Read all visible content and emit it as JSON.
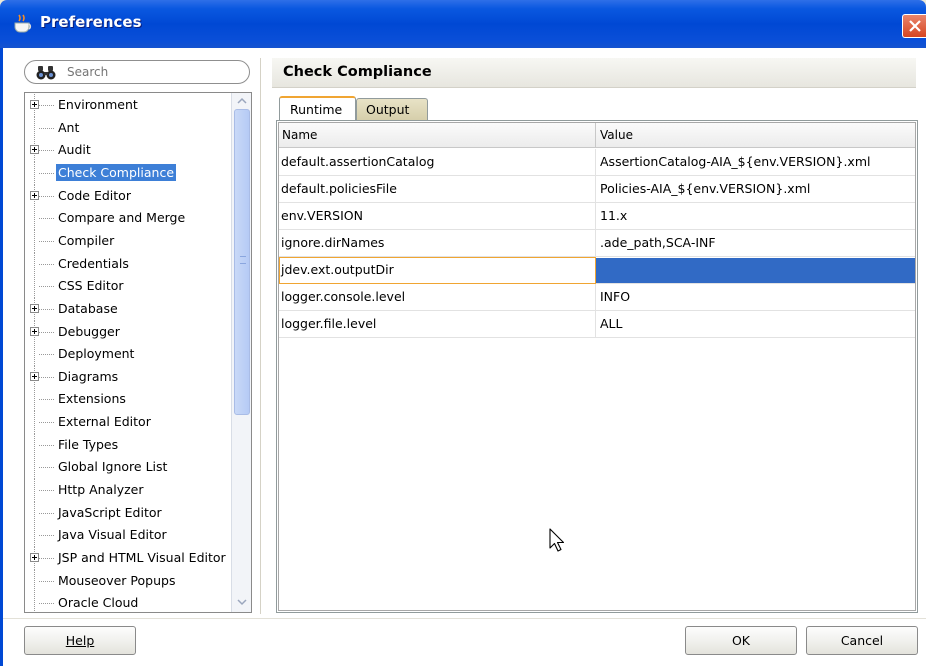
{
  "window": {
    "title": "Preferences"
  },
  "search": {
    "placeholder": "Search"
  },
  "tree": {
    "items": [
      {
        "label": "Environment",
        "expandable": true,
        "selected": false
      },
      {
        "label": "Ant",
        "expandable": false,
        "selected": false
      },
      {
        "label": "Audit",
        "expandable": true,
        "selected": false
      },
      {
        "label": "Check Compliance",
        "expandable": false,
        "selected": true
      },
      {
        "label": "Code Editor",
        "expandable": true,
        "selected": false
      },
      {
        "label": "Compare and Merge",
        "expandable": false,
        "selected": false
      },
      {
        "label": "Compiler",
        "expandable": false,
        "selected": false
      },
      {
        "label": "Credentials",
        "expandable": false,
        "selected": false
      },
      {
        "label": "CSS Editor",
        "expandable": false,
        "selected": false
      },
      {
        "label": "Database",
        "expandable": true,
        "selected": false
      },
      {
        "label": "Debugger",
        "expandable": true,
        "selected": false
      },
      {
        "label": "Deployment",
        "expandable": false,
        "selected": false
      },
      {
        "label": "Diagrams",
        "expandable": true,
        "selected": false
      },
      {
        "label": "Extensions",
        "expandable": false,
        "selected": false
      },
      {
        "label": "External Editor",
        "expandable": false,
        "selected": false
      },
      {
        "label": "File Types",
        "expandable": false,
        "selected": false
      },
      {
        "label": "Global Ignore List",
        "expandable": false,
        "selected": false
      },
      {
        "label": "Http Analyzer",
        "expandable": false,
        "selected": false
      },
      {
        "label": "JavaScript Editor",
        "expandable": false,
        "selected": false
      },
      {
        "label": "Java Visual Editor",
        "expandable": false,
        "selected": false
      },
      {
        "label": "JSP and HTML Visual Editor",
        "expandable": true,
        "selected": false
      },
      {
        "label": "Mouseover Popups",
        "expandable": false,
        "selected": false
      },
      {
        "label": "Oracle Cloud",
        "expandable": false,
        "selected": false
      }
    ]
  },
  "panel": {
    "title": "Check Compliance",
    "tabs": [
      {
        "label": "Runtime",
        "active": true
      },
      {
        "label": "Output",
        "active": false
      }
    ],
    "columns": {
      "name": "Name",
      "value": "Value"
    },
    "rows": [
      {
        "name": "default.assertionCatalog",
        "value": "AssertionCatalog-AIA_${env.VERSION}.xml"
      },
      {
        "name": "default.policiesFile",
        "value": "Policies-AIA_${env.VERSION}.xml"
      },
      {
        "name": "env.VERSION",
        "value": "11.x"
      },
      {
        "name": "ignore.dirNames",
        "value": ".ade_path,SCA-INF"
      },
      {
        "name": "jdev.ext.outputDir",
        "value": "",
        "editing": true
      },
      {
        "name": "logger.console.level",
        "value": "INFO"
      },
      {
        "name": "logger.file.level",
        "value": "ALL"
      }
    ]
  },
  "buttons": {
    "help": "Help",
    "ok": "OK",
    "cancel": "Cancel"
  },
  "colors": {
    "titlebar": "#0048d4",
    "selection": "#3d7fd7",
    "active_tab_accent": "#f0a532",
    "editing_cell": "#316ac5"
  }
}
